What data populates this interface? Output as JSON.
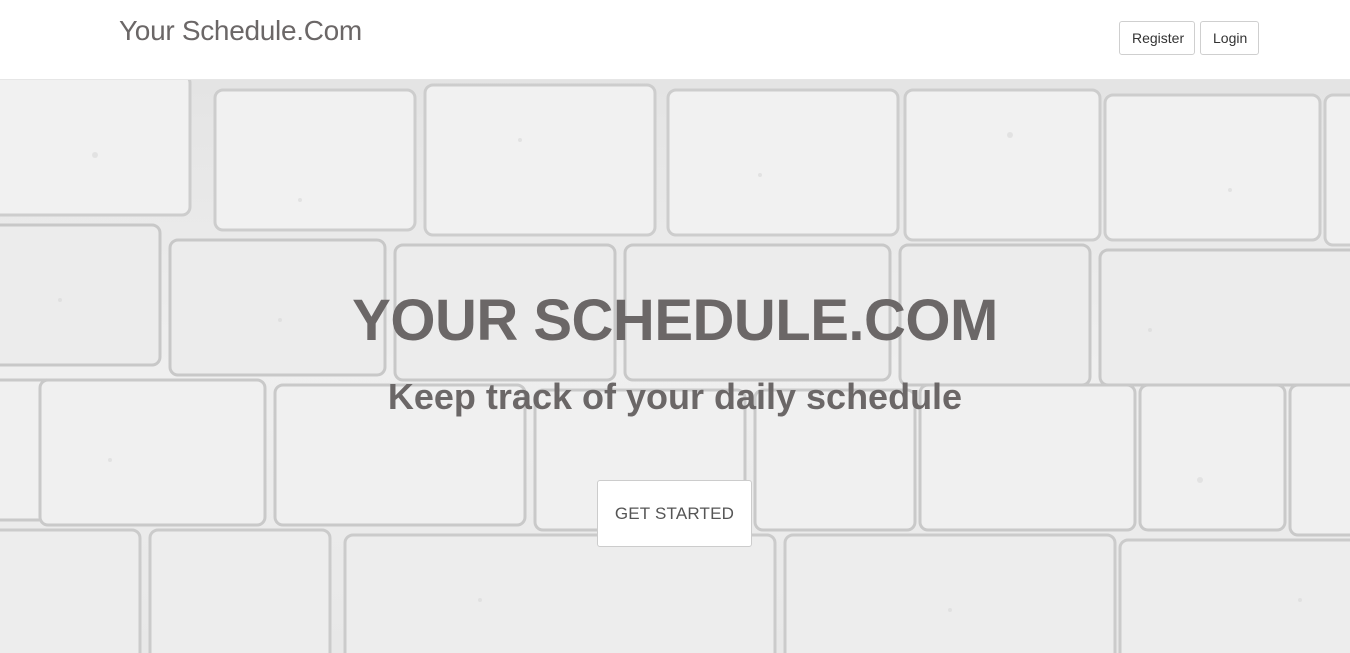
{
  "navbar": {
    "brand": "Your Schedule.Com",
    "register_label": "Register",
    "login_label": "Login"
  },
  "hero": {
    "title": "YOUR SCHEDULE.COM",
    "subtitle": "Keep track of your daily schedule",
    "cta_label": "GET STARTED"
  },
  "colors": {
    "text_gray": "#6b6767",
    "brick_background": "#eaeaea",
    "mortar": "#c9c9c9"
  }
}
